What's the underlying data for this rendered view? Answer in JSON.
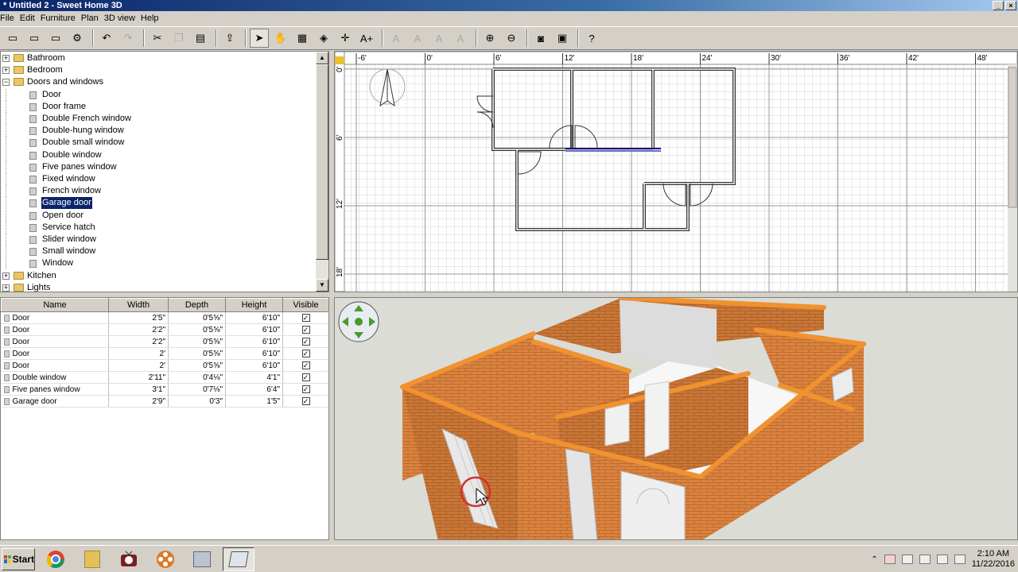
{
  "window": {
    "title": "* Untitled 2 - Sweet Home 3D"
  },
  "menu": [
    "File",
    "Edit",
    "Furniture",
    "Plan",
    "3D view",
    "Help"
  ],
  "toolbar": [
    {
      "name": "new-home-button",
      "glyph": "▭"
    },
    {
      "name": "open-button",
      "glyph": "▭"
    },
    {
      "name": "save-button",
      "glyph": "▭"
    },
    {
      "name": "preferences-button",
      "glyph": "⚙"
    },
    {
      "sep": true
    },
    {
      "name": "undo-button",
      "glyph": "↶"
    },
    {
      "name": "redo-button",
      "glyph": "↷",
      "disabled": true
    },
    {
      "sep": true
    },
    {
      "name": "cut-button",
      "glyph": "✂"
    },
    {
      "name": "copy-button",
      "glyph": "❐",
      "disabled": true
    },
    {
      "name": "paste-button",
      "glyph": "▤"
    },
    {
      "sep": true
    },
    {
      "name": "add-furniture-button",
      "glyph": "⇪"
    },
    {
      "sep": true
    },
    {
      "name": "select-mode-button",
      "glyph": "➤",
      "selected": true
    },
    {
      "name": "pan-mode-button",
      "glyph": "✋"
    },
    {
      "name": "create-walls-button",
      "glyph": "▦"
    },
    {
      "name": "create-rooms-button",
      "glyph": "◈"
    },
    {
      "name": "create-dimensions-button",
      "glyph": "✛"
    },
    {
      "name": "add-text-button",
      "glyph": "A+"
    },
    {
      "sep": true
    },
    {
      "name": "modify-text-style-1",
      "glyph": "A",
      "disabled": true
    },
    {
      "name": "modify-text-style-2",
      "glyph": "A",
      "disabled": true
    },
    {
      "name": "modify-text-style-3",
      "glyph": "A",
      "disabled": true
    },
    {
      "name": "modify-text-style-4",
      "glyph": "A",
      "disabled": true
    },
    {
      "sep": true
    },
    {
      "name": "zoom-in-button",
      "glyph": "⊕"
    },
    {
      "name": "zoom-out-button",
      "glyph": "⊖"
    },
    {
      "sep": true
    },
    {
      "name": "create-photo-button",
      "glyph": "◙"
    },
    {
      "name": "create-video-button",
      "glyph": "▣"
    },
    {
      "sep": true
    },
    {
      "name": "help-button",
      "glyph": "?"
    }
  ],
  "catalog": [
    {
      "type": "category",
      "label": "Bathroom",
      "expanded": false
    },
    {
      "type": "category",
      "label": "Bedroom",
      "expanded": false
    },
    {
      "type": "category",
      "label": "Doors and windows",
      "expanded": true
    },
    {
      "type": "item",
      "label": "Door"
    },
    {
      "type": "item",
      "label": "Door frame"
    },
    {
      "type": "item",
      "label": "Double French window"
    },
    {
      "type": "item",
      "label": "Double-hung window"
    },
    {
      "type": "item",
      "label": "Double small window"
    },
    {
      "type": "item",
      "label": "Double window"
    },
    {
      "type": "item",
      "label": "Five panes window"
    },
    {
      "type": "item",
      "label": "Fixed window"
    },
    {
      "type": "item",
      "label": "French window"
    },
    {
      "type": "item",
      "label": "Garage door",
      "selected": true
    },
    {
      "type": "item",
      "label": "Open door"
    },
    {
      "type": "item",
      "label": "Service hatch"
    },
    {
      "type": "item",
      "label": "Slider window"
    },
    {
      "type": "item",
      "label": "Small window"
    },
    {
      "type": "item",
      "label": "Window"
    },
    {
      "type": "category",
      "label": "Kitchen",
      "expanded": false
    },
    {
      "type": "category",
      "label": "Lights",
      "expanded": false
    }
  ],
  "furniture_table": {
    "columns": [
      "Name",
      "Width",
      "Depth",
      "Height",
      "Visible"
    ],
    "rows": [
      {
        "name": "Door",
        "width": "2'5\"",
        "depth": "0'5⅝\"",
        "height": "6'10\"",
        "visible": true
      },
      {
        "name": "Door",
        "width": "2'2\"",
        "depth": "0'5⅝\"",
        "height": "6'10\"",
        "visible": true
      },
      {
        "name": "Door",
        "width": "2'2\"",
        "depth": "0'5⅝\"",
        "height": "6'10\"",
        "visible": true
      },
      {
        "name": "Door",
        "width": "2'",
        "depth": "0'5⅝\"",
        "height": "6'10\"",
        "visible": true
      },
      {
        "name": "Door",
        "width": "2'",
        "depth": "0'5⅝\"",
        "height": "6'10\"",
        "visible": true
      },
      {
        "name": "Double window",
        "width": "2'11\"",
        "depth": "0'4⅛\"",
        "height": "4'1\"",
        "visible": true
      },
      {
        "name": "Five panes window",
        "width": "3'1\"",
        "depth": "0'7⅛\"",
        "height": "6'4\"",
        "visible": true
      },
      {
        "name": "Garage door",
        "width": "2'9\"",
        "depth": "0'3\"",
        "height": "1'5\"",
        "visible": true
      }
    ]
  },
  "plan": {
    "x_ruler": [
      "-6'",
      "0'",
      "6'",
      "12'",
      "18'",
      "24'",
      "30'",
      "36'",
      "42'",
      "48'"
    ],
    "y_ruler": [
      "0'",
      "6'",
      "12'",
      "18'"
    ]
  },
  "taskbar": {
    "start_label": "Start",
    "time": "2:10 AM",
    "date": "11/22/2016"
  },
  "colors": {
    "titlebar": "#0a246a",
    "selection": "#0a246a",
    "brick": "#d9833f",
    "wall_top": "#f08a2a",
    "wall_plan": "#333333"
  }
}
